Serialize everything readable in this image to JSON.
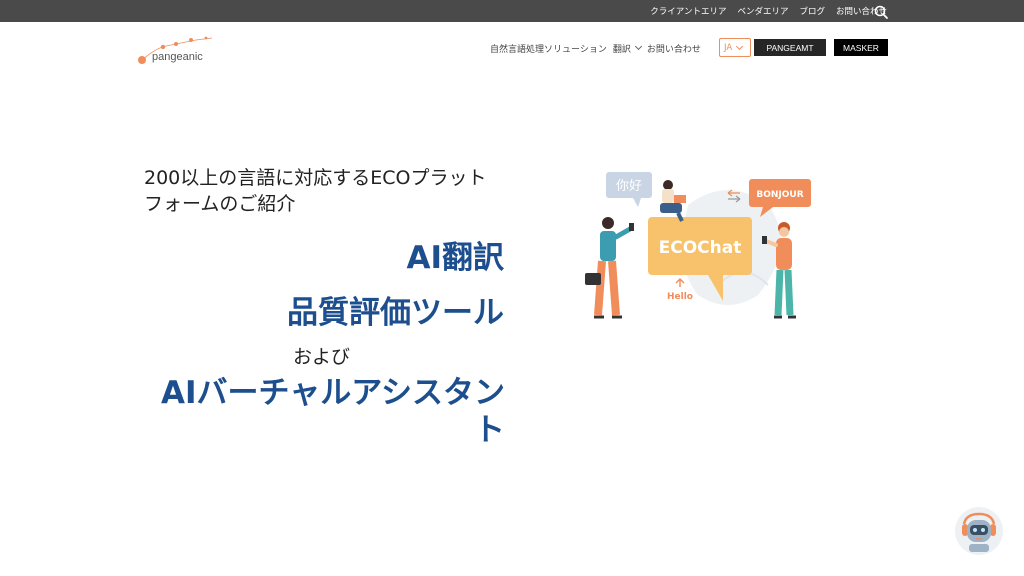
{
  "topbar": {
    "links": [
      "クライアントエリア",
      "ベンダエリア",
      "ブログ",
      "お問い合わせ"
    ]
  },
  "header": {
    "logo_text": "pangeanic",
    "nav": [
      {
        "label": "自然言語処理ソリューション",
        "has_dropdown": false
      },
      {
        "label": "翻訳",
        "has_dropdown": true
      },
      {
        "label": "お問い合わせ",
        "has_dropdown": false
      }
    ],
    "language": "JA",
    "pangeamt_label": "PANGEAMT",
    "masker_label": "MASKER"
  },
  "hero": {
    "intro": "200以上の言語に対応するECOプラットフォームのご紹介",
    "heading_ai_translation": "AI翻訳",
    "heading_quality": "品質評価ツール",
    "and_text": "および",
    "heading_virtual_assistant": "AIバーチャルアシスタント"
  },
  "illustration": {
    "bubble_chinese": "你好",
    "bubble_bonjour": "BONJOUR",
    "bubble_ecochat": "ECOChat",
    "bubble_hello": "Hello"
  },
  "colors": {
    "accent": "#f08d5a",
    "heading_blue": "#1d4f8e",
    "topbar": "#4a4a4a"
  }
}
